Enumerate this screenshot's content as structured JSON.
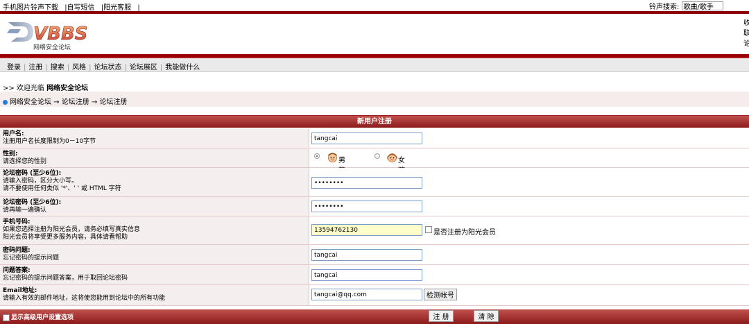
{
  "topbar": {
    "links": [
      "手机图片铃声下载",
      "|自写短信",
      "|阳光客服",
      "|"
    ],
    "search_label": "铃声搜索:",
    "search_value": "歌曲/歌手"
  },
  "logo": {
    "text": "VBBS",
    "subtitle": "网络安全论坛"
  },
  "header_right": [
    "收",
    "联",
    "论"
  ],
  "menu": [
    "登录",
    "注册",
    "搜索",
    "风格",
    "论坛状态",
    "论坛展区",
    "我能做什么"
  ],
  "welcome": {
    "prefix": ">> 欢迎光临",
    "forum": "网络安全论坛"
  },
  "breadcrumb": "网络安全论坛 → 论坛注册 → 论坛注册",
  "form": {
    "title": "新用户注册",
    "username": {
      "label": "用户名:",
      "desc": "注册用户名长度限制为0－10字节",
      "value": "tangcai"
    },
    "gender": {
      "label": "性别:",
      "desc": "请选择您的性别",
      "male": "男孩",
      "female": "女孩"
    },
    "password": {
      "label": "论坛密码 (至少6位):",
      "desc1": "请输入密码，区分大小写。",
      "desc2": "请不要使用任何类似 '*'、' ' 或 HTML 字符",
      "value": "••••••••"
    },
    "password2": {
      "label": "论坛密码 (至少6位):",
      "desc": "请再输一遍确认",
      "value": "••••••••"
    },
    "phone": {
      "label": "手机号码:",
      "desc1": "如果您选择注册为阳光会员，请务必填写真实信息",
      "desc2": "阳光会员将享受更多服务内容，具体请看帮助",
      "value": "13594762130",
      "checkbox_label": "是否注册为阳光会员"
    },
    "question": {
      "label": "密码问题:",
      "desc": "忘记密码的提示问题",
      "value": "tangcai"
    },
    "answer": {
      "label": "问题答案:",
      "desc": "忘记密码的提示问题答案，用于取回论坛密码",
      "value": "tangcai"
    },
    "email": {
      "label": "Email地址:",
      "desc": "请输入有效的邮件地址，这将使您能用到论坛中的所有功能",
      "value": "tangcai@qq.com",
      "check_button": "检测帐号"
    }
  },
  "footer": {
    "advanced_label": "显示高级用户设置选项",
    "submit": "注 册",
    "reset": "清 除"
  },
  "colors": {
    "brand_red": "#8b0000",
    "accent_blue": "#2a7bd4"
  }
}
